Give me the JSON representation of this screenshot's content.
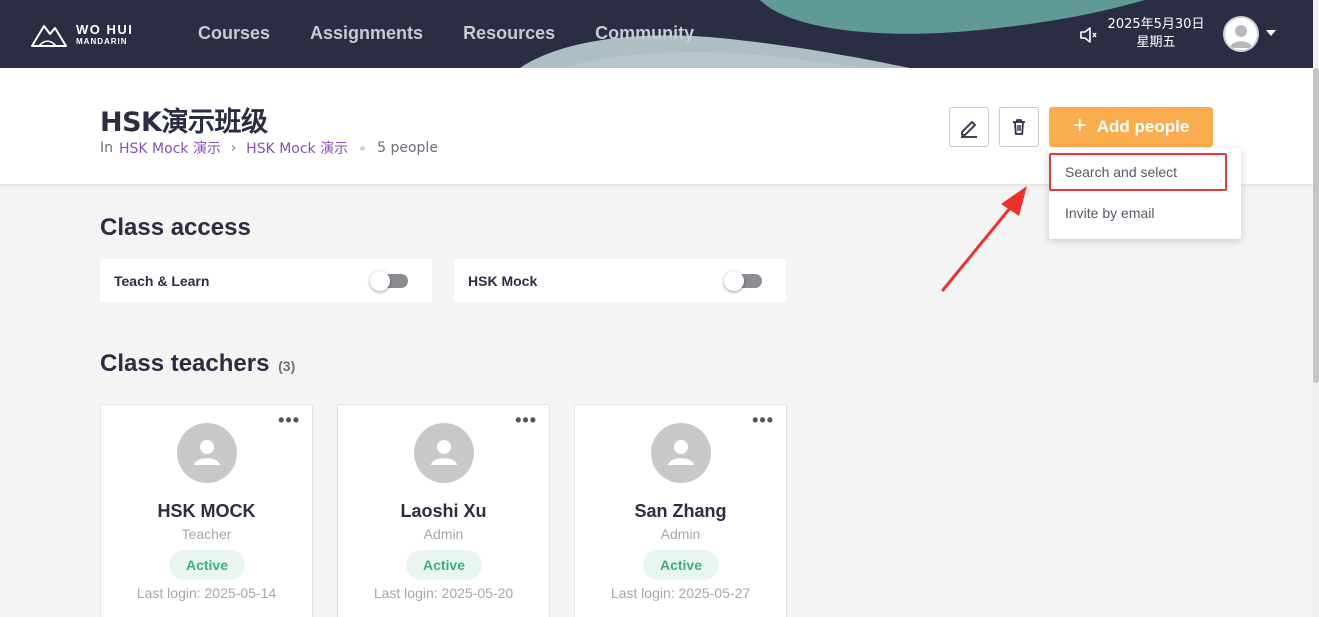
{
  "nav": {
    "brand_line1": "WO HUI",
    "brand_line2": "MANDARIN",
    "links": [
      "Courses",
      "Assignments",
      "Resources",
      "Community"
    ],
    "date": "2025年5月30日",
    "weekday": "星期五",
    "colors": {
      "nav_bg": "#2b2d45",
      "wave_teal": "#5f9a97",
      "wave_light": "#aebfc4"
    }
  },
  "header": {
    "title": "HSK演示班级",
    "breadcrumb_prefix": "In",
    "breadcrumb_1": "HSK Mock 演示",
    "breadcrumb_2": "HSK Mock 演示",
    "people_count": "5 people",
    "add_people_label": "Add people",
    "edit_icon": "pencil-icon",
    "delete_icon": "trash-icon"
  },
  "dropdown": {
    "items": [
      "Search and select",
      "Invite by email"
    ]
  },
  "class_access": {
    "title": "Class access",
    "items": [
      {
        "label": "Teach & Learn",
        "enabled": false
      },
      {
        "label": "HSK Mock",
        "enabled": false
      }
    ]
  },
  "teachers": {
    "title": "Class teachers",
    "count": "(3)",
    "cards": [
      {
        "name": "HSK MOCK",
        "role": "Teacher",
        "status": "Active",
        "last_login": "Last login: 2025-05-14"
      },
      {
        "name": "Laoshi Xu",
        "role": "Admin",
        "status": "Active",
        "last_login": "Last login: 2025-05-20"
      },
      {
        "name": "San Zhang",
        "role": "Admin",
        "status": "Active",
        "last_login": "Last login: 2025-05-27"
      }
    ]
  },
  "colors": {
    "accent_orange": "#f9ad4e",
    "link_purple": "#8a4fb3",
    "active_green": "#3fb07a",
    "highlight_red": "#e23b3b"
  }
}
